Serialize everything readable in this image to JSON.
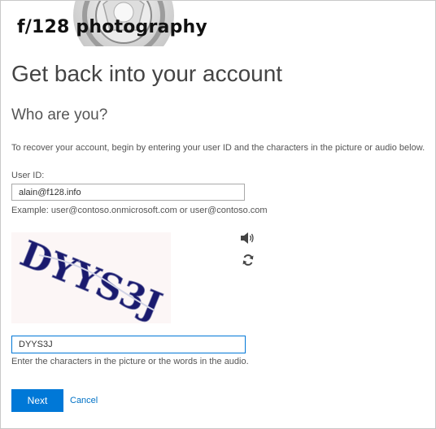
{
  "brand": {
    "logo_text": "f/128 photography"
  },
  "page": {
    "title": "Get back into your account",
    "subtitle": "Who are you?",
    "instructions": "To recover your account, begin by entering your user ID and the characters in the picture or audio below."
  },
  "user_id": {
    "label": "User ID:",
    "value": "alain@f128.info",
    "example": "Example: user@contoso.onmicrosoft.com or user@contoso.com"
  },
  "captcha": {
    "image_text": "DYYS3J",
    "audio_icon": "speaker-icon",
    "refresh_icon": "refresh-icon",
    "input_value": "DYYS3J",
    "help": "Enter the characters in the picture or the words in the audio."
  },
  "actions": {
    "next_label": "Next",
    "cancel_label": "Cancel"
  },
  "colors": {
    "accent": "#0078d7",
    "link": "#0072c6",
    "captcha_ink": "#1a1a6e",
    "captcha_bg": "#fcf6f6"
  }
}
